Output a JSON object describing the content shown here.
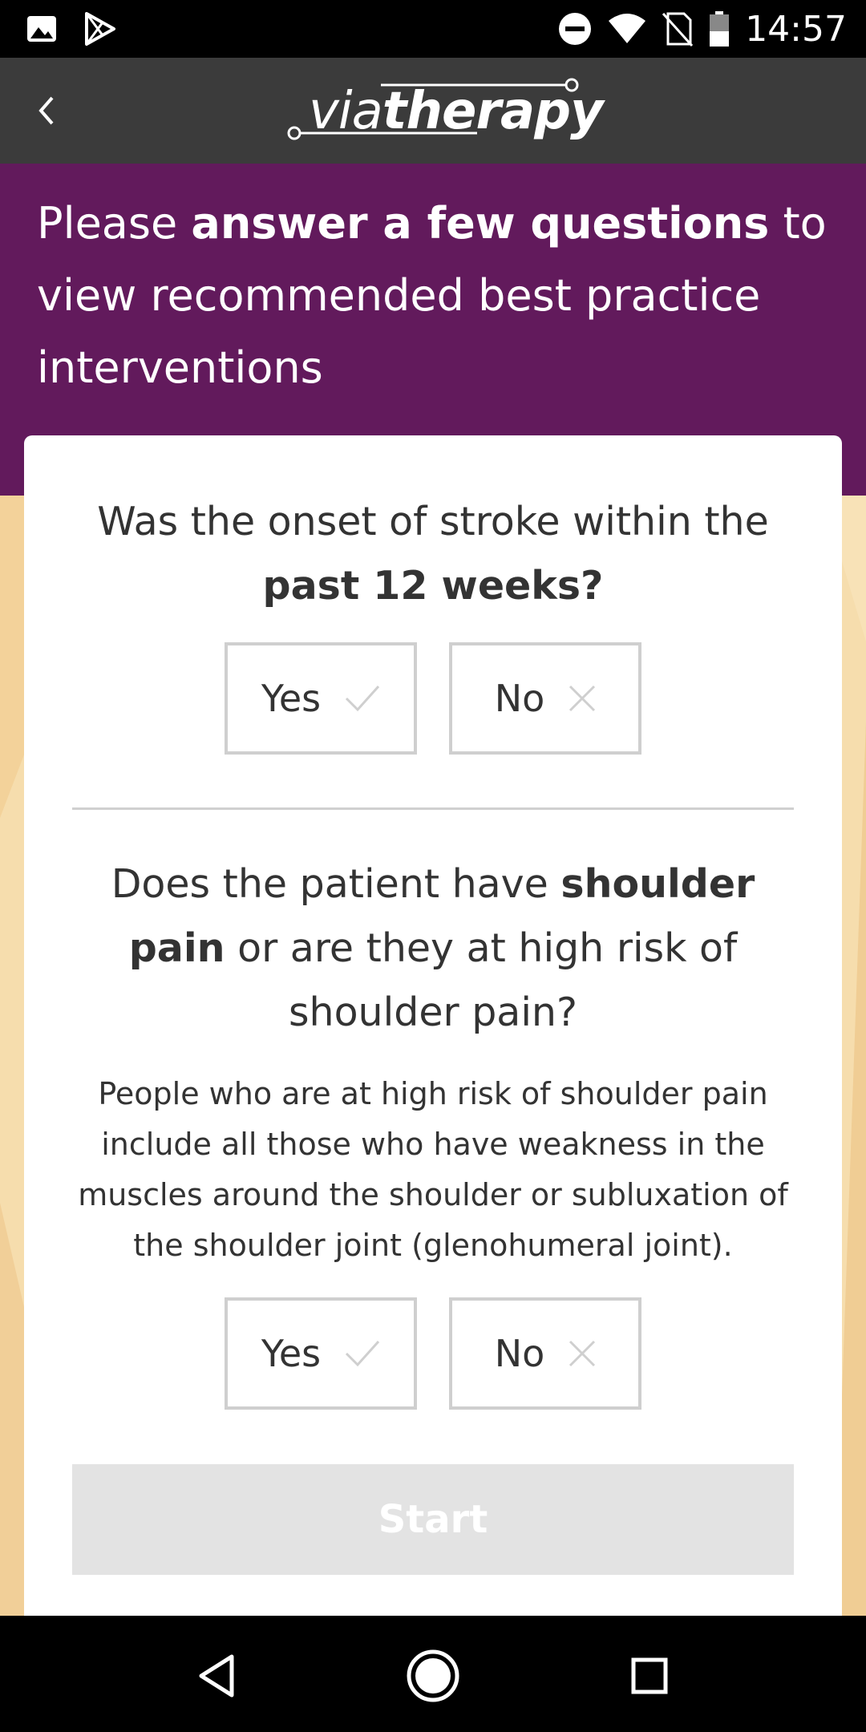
{
  "status_bar": {
    "time": "14:57",
    "icons": [
      "image-icon",
      "play-store-icon",
      "do-not-disturb-icon",
      "wifi-icon",
      "no-sim-icon",
      "battery-icon"
    ]
  },
  "app_bar": {
    "logo_light": "via",
    "logo_bold": "therapy"
  },
  "hero": {
    "text_pre": "Please ",
    "text_bold": "answer a few questions",
    "text_post": " to view recommended best practice interventions"
  },
  "questions": [
    {
      "text_pre": "Was the onset of stroke within the ",
      "text_bold": "past 12 weeks?",
      "text_post": "",
      "yes_label": "Yes",
      "no_label": "No"
    },
    {
      "text_pre": "Does the patient have ",
      "text_bold": "shoulder pain",
      "text_post": " or are they at high risk of shoulder pain?",
      "note": "People who are at high risk of shoulder pain include all those who have weakness in the muscles around the shoulder or subluxation of the shoulder joint (glenohumeral joint).",
      "yes_label": "Yes",
      "no_label": "No"
    }
  ],
  "start_label": "Start",
  "colors": {
    "header_purple": "#621a5c",
    "app_bar": "#3b3b3b",
    "background": "#f6ddad",
    "start_disabled": "#e3e3e3"
  }
}
